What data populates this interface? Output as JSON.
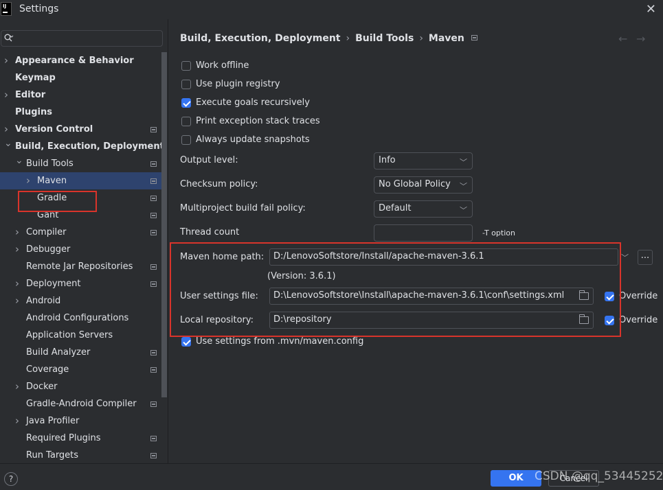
{
  "window": {
    "title": "Settings",
    "logo_text": "IJ"
  },
  "search": {
    "placeholder": "",
    "value": ""
  },
  "tree": [
    {
      "label": "Appearance & Behavior",
      "level": 0,
      "chevron": "right",
      "bold": true,
      "badge": false
    },
    {
      "label": "Keymap",
      "level": 0,
      "chevron": "",
      "bold": true,
      "badge": false
    },
    {
      "label": "Editor",
      "level": 0,
      "chevron": "right",
      "bold": true,
      "badge": false
    },
    {
      "label": "Plugins",
      "level": 0,
      "chevron": "",
      "bold": true,
      "badge": false
    },
    {
      "label": "Version Control",
      "level": 0,
      "chevron": "right",
      "bold": true,
      "badge": true
    },
    {
      "label": "Build, Execution, Deployment",
      "level": 0,
      "chevron": "down",
      "bold": true,
      "badge": false
    },
    {
      "label": "Build Tools",
      "level": 1,
      "chevron": "down",
      "bold": false,
      "badge": true
    },
    {
      "label": "Maven",
      "level": 2,
      "chevron": "right",
      "bold": false,
      "badge": true,
      "selected": true
    },
    {
      "label": "Gradle",
      "level": 2,
      "chevron": "",
      "bold": false,
      "badge": true
    },
    {
      "label": "Gant",
      "level": 2,
      "chevron": "",
      "bold": false,
      "badge": true
    },
    {
      "label": "Compiler",
      "level": 1,
      "chevron": "right",
      "bold": false,
      "badge": true
    },
    {
      "label": "Debugger",
      "level": 1,
      "chevron": "right",
      "bold": false,
      "badge": false
    },
    {
      "label": "Remote Jar Repositories",
      "level": 1,
      "chevron": "",
      "bold": false,
      "badge": true
    },
    {
      "label": "Deployment",
      "level": 1,
      "chevron": "right",
      "bold": false,
      "badge": true
    },
    {
      "label": "Android",
      "level": 1,
      "chevron": "right",
      "bold": false,
      "badge": false
    },
    {
      "label": "Android Configurations",
      "level": 1,
      "chevron": "",
      "bold": false,
      "badge": false
    },
    {
      "label": "Application Servers",
      "level": 1,
      "chevron": "",
      "bold": false,
      "badge": false
    },
    {
      "label": "Build Analyzer",
      "level": 1,
      "chevron": "",
      "bold": false,
      "badge": true
    },
    {
      "label": "Coverage",
      "level": 1,
      "chevron": "",
      "bold": false,
      "badge": true
    },
    {
      "label": "Docker",
      "level": 1,
      "chevron": "right",
      "bold": false,
      "badge": false
    },
    {
      "label": "Gradle-Android Compiler",
      "level": 1,
      "chevron": "",
      "bold": false,
      "badge": true
    },
    {
      "label": "Java Profiler",
      "level": 1,
      "chevron": "right",
      "bold": false,
      "badge": false
    },
    {
      "label": "Required Plugins",
      "level": 1,
      "chevron": "",
      "bold": false,
      "badge": true
    },
    {
      "label": "Run Targets",
      "level": 1,
      "chevron": "",
      "bold": false,
      "badge": true
    }
  ],
  "breadcrumb": {
    "part1": "Build, Execution, Deployment",
    "part2": "Build Tools",
    "part3": "Maven",
    "separator": "›"
  },
  "checkboxes": [
    {
      "label": "Work offline",
      "checked": false
    },
    {
      "label": "Use plugin registry",
      "checked": false
    },
    {
      "label": "Execute goals recursively",
      "checked": true
    },
    {
      "label": "Print exception stack traces",
      "checked": false
    },
    {
      "label": "Always update snapshots",
      "checked": false
    }
  ],
  "output_level": {
    "label": "Output level:",
    "value": "Info"
  },
  "checksum_policy": {
    "label": "Checksum policy:",
    "value": "No Global Policy"
  },
  "multiproject_policy": {
    "label": "Multiproject build fail policy:",
    "value": "Default"
  },
  "thread_count": {
    "label": "Thread count",
    "value": "",
    "hint": "-T option"
  },
  "maven_home": {
    "label": "Maven home path:",
    "value": "D:/LenovoSoftstore/Install/apache-maven-3.6.1",
    "version": "(Version: 3.6.1)",
    "more": "..."
  },
  "user_settings": {
    "label": "User settings file:",
    "value": "D:\\LenovoSoftstore\\Install\\apache-maven-3.6.1\\conf\\settings.xml",
    "override_label": "Override",
    "override_checked": true
  },
  "local_repo": {
    "label": "Local repository:",
    "value": "D:\\repository",
    "override_label": "Override",
    "override_checked": true
  },
  "use_mvn_config": {
    "label": "Use settings from .mvn/maven.config",
    "checked": true
  },
  "footer": {
    "help": "?",
    "ok": "OK",
    "cancel": "Cancel",
    "watermark": "CSDN @qq_53445252"
  },
  "colors": {
    "accent": "#3574f0",
    "highlight_border": "#d9342b",
    "selected_bg": "#2e436e",
    "background": "#2b2d30"
  },
  "icons": [
    "search-icon",
    "close-icon",
    "chevron-right-icon",
    "chevron-down-icon",
    "settings-badge-icon",
    "folder-icon",
    "back-arrow-icon",
    "forward-arrow-icon",
    "help-icon"
  ]
}
